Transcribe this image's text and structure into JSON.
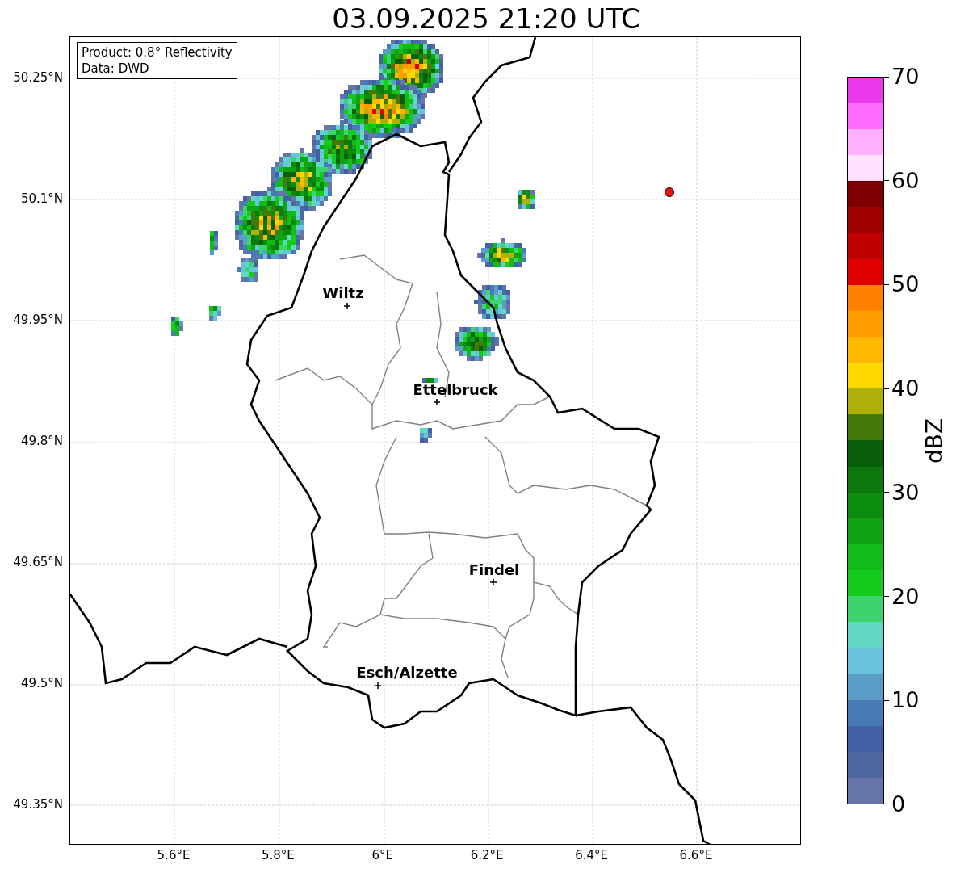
{
  "title": "03.09.2025 21:20 UTC",
  "info_box": {
    "lines": [
      "Product: 0.8° Reflectivity",
      "Data: DWD"
    ]
  },
  "map": {
    "y_ticks": [
      "50.25°N",
      "50.1°N",
      "49.95°N",
      "49.8°N",
      "49.65°N",
      "49.5°N",
      "49.35°N"
    ],
    "x_ticks": [
      "5.6°E",
      "5.8°E",
      "6°E",
      "6.2°E",
      "6.4°E",
      "6.6°E"
    ],
    "cities": [
      {
        "name": "Wiltz"
      },
      {
        "name": "Ettelbruck"
      },
      {
        "name": "Findel"
      },
      {
        "name": "Esch/Alzette"
      }
    ]
  },
  "colorbar": {
    "label": "dBZ",
    "ticks": [
      "70",
      "60",
      "50",
      "40",
      "30",
      "20",
      "10",
      "0"
    ],
    "segments": [
      {
        "color": "#6675a8"
      },
      {
        "color": "#5068a0"
      },
      {
        "color": "#4360a4"
      },
      {
        "color": "#4a7ab4"
      },
      {
        "color": "#5a9ec8"
      },
      {
        "color": "#68c4dc"
      },
      {
        "color": "#62d8c4"
      },
      {
        "color": "#3cd46c"
      },
      {
        "color": "#14cc1c"
      },
      {
        "color": "#10bc18"
      },
      {
        "color": "#10a414"
      },
      {
        "color": "#0c8c0c"
      },
      {
        "color": "#0c780c"
      },
      {
        "color": "#0a600a"
      },
      {
        "color": "#447808"
      },
      {
        "color": "#acb008"
      },
      {
        "color": "#ffd800"
      },
      {
        "color": "#ffb800"
      },
      {
        "color": "#ff9c00"
      },
      {
        "color": "#ff8000"
      },
      {
        "color": "#e00000"
      },
      {
        "color": "#c00000"
      },
      {
        "color": "#a00000"
      },
      {
        "color": "#7c0000"
      },
      {
        "color": "#ffe0ff"
      },
      {
        "color": "#ffb0ff"
      },
      {
        "color": "#ff6cff"
      },
      {
        "color": "#ec38ec"
      }
    ]
  }
}
